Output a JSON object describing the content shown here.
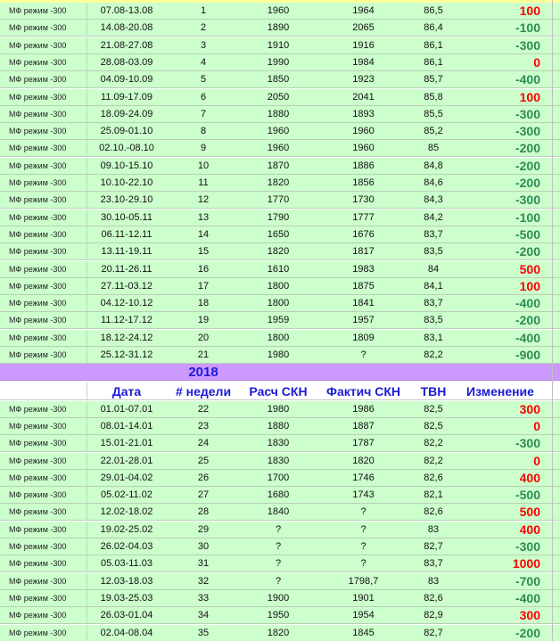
{
  "label_prefix": "МФ режим -300",
  "year_title": "2018",
  "headers": [
    "Дата",
    "# недели",
    "Расч СКН",
    "Фактич СКН",
    "ТВН",
    "Изменение"
  ],
  "rows_2017": [
    {
      "label": "МФ режим -300",
      "date": "07.08-13.08",
      "week": "1",
      "calc": "1960",
      "fact": "1964",
      "tvn": "86,5",
      "change": "100",
      "sign": "pos"
    },
    {
      "label": "МФ режим -300",
      "date": "14.08-20.08",
      "week": "2",
      "calc": "1890",
      "fact": "2065",
      "tvn": "86,4",
      "change": "-100",
      "sign": "neg"
    },
    {
      "label": "МФ режим -300",
      "date": "21.08-27.08",
      "week": "3",
      "calc": "1910",
      "fact": "1916",
      "tvn": "86,1",
      "change": "-300",
      "sign": "neg"
    },
    {
      "label": "МФ режим -300",
      "date": "28.08-03.09",
      "week": "4",
      "calc": "1990",
      "fact": "1984",
      "tvn": "86,1",
      "change": "0",
      "sign": "pos"
    },
    {
      "label": "МФ режим -300",
      "date": "04.09-10.09",
      "week": "5",
      "calc": "1850",
      "fact": "1923",
      "tvn": "85,7",
      "change": "-400",
      "sign": "neg"
    },
    {
      "label": "МФ режим -300",
      "date": "11.09-17.09",
      "week": "6",
      "calc": "2050",
      "fact": "2041",
      "tvn": "85,8",
      "change": "100",
      "sign": "pos"
    },
    {
      "label": "МФ режим -300",
      "date": "18.09-24.09",
      "week": "7",
      "calc": "1880",
      "fact": "1893",
      "tvn": "85,5",
      "change": "-300",
      "sign": "neg"
    },
    {
      "label": "МФ режим -300",
      "date": "25.09-01.10",
      "week": "8",
      "calc": "1960",
      "fact": "1960",
      "tvn": "85,2",
      "change": "-300",
      "sign": "neg"
    },
    {
      "label": "МФ режим -300",
      "date": "02.10.-08.10",
      "week": "9",
      "calc": "1960",
      "fact": "1960",
      "tvn": "85",
      "change": "-200",
      "sign": "neg"
    },
    {
      "label": "МФ режим -300",
      "date": "09.10-15.10",
      "week": "10",
      "calc": "1870",
      "fact": "1886",
      "tvn": "84,8",
      "change": "-200",
      "sign": "neg"
    },
    {
      "label": "МФ режим -300",
      "date": "10.10-22.10",
      "week": "11",
      "calc": "1820",
      "fact": "1856",
      "tvn": "84,6",
      "change": "-200",
      "sign": "neg"
    },
    {
      "label": "МФ режим -300",
      "date": "23.10-29.10",
      "week": "12",
      "calc": "1770",
      "fact": "1730",
      "tvn": "84,3",
      "change": "-300",
      "sign": "neg"
    },
    {
      "label": "МФ режим -300",
      "date": "30.10-05.11",
      "week": "13",
      "calc": "1790",
      "fact": "1777",
      "tvn": "84,2",
      "change": "-100",
      "sign": "neg"
    },
    {
      "label": "МФ режим -300",
      "date": "06.11-12.11",
      "week": "14",
      "calc": "1650",
      "fact": "1676",
      "tvn": "83,7",
      "change": "-500",
      "sign": "neg"
    },
    {
      "label": "МФ режим -300",
      "date": "13.11-19.11",
      "week": "15",
      "calc": "1820",
      "fact": "1817",
      "tvn": "83,5",
      "change": "-200",
      "sign": "neg"
    },
    {
      "label": "МФ режим -300",
      "date": "20.11-26.11",
      "week": "16",
      "calc": "1610",
      "fact": "1983",
      "tvn": "84",
      "change": "500",
      "sign": "pos"
    },
    {
      "label": "МФ режим -300",
      "date": "27.11-03.12",
      "week": "17",
      "calc": "1800",
      "fact": "1875",
      "tvn": "84,1",
      "change": "100",
      "sign": "pos"
    },
    {
      "label": "МФ режим -300",
      "date": "04.12-10.12",
      "week": "18",
      "calc": "1800",
      "fact": "1841",
      "tvn": "83,7",
      "change": "-400",
      "sign": "neg"
    },
    {
      "label": "МФ режим -300",
      "date": "11.12-17.12",
      "week": "19",
      "calc": "1959",
      "fact": "1957",
      "tvn": "83,5",
      "change": "-200",
      "sign": "neg"
    },
    {
      "label": "МФ режим -300",
      "date": "18.12-24.12",
      "week": "20",
      "calc": "1800",
      "fact": "1809",
      "tvn": "83,1",
      "change": "-400",
      "sign": "neg"
    },
    {
      "label": "МФ режим -300",
      "date": "25.12-31.12",
      "week": "21",
      "calc": "1980",
      "fact": "?",
      "tvn": "82,2",
      "change": "-900",
      "sign": "neg"
    }
  ],
  "rows_2018": [
    {
      "label": "МФ режим -300",
      "date": "01.01-07.01",
      "week": "22",
      "calc": "1980",
      "fact": "1986",
      "tvn": "82,5",
      "change": "300",
      "sign": "pos"
    },
    {
      "label": "МФ режим -300",
      "date": "08.01-14.01",
      "week": "23",
      "calc": "1880",
      "fact": "1887",
      "tvn": "82,5",
      "change": "0",
      "sign": "pos"
    },
    {
      "label": "МФ режим -300",
      "date": "15.01-21.01",
      "week": "24",
      "calc": "1830",
      "fact": "1787",
      "tvn": "82,2",
      "change": "-300",
      "sign": "neg"
    },
    {
      "label": "МФ режим -300",
      "date": "22.01-28.01",
      "week": "25",
      "calc": "1830",
      "fact": "1820",
      "tvn": "82,2",
      "change": "0",
      "sign": "pos"
    },
    {
      "label": "МФ режим -300",
      "date": "29.01-04.02",
      "week": "26",
      "calc": "1700",
      "fact": "1746",
      "tvn": "82,6",
      "change": "400",
      "sign": "pos"
    },
    {
      "label": "МФ режим -300",
      "date": "05.02-11.02",
      "week": "27",
      "calc": "1680",
      "fact": "1743",
      "tvn": "82,1",
      "change": "-500",
      "sign": "neg"
    },
    {
      "label": "МФ режим -300",
      "date": "12.02-18.02",
      "week": "28",
      "calc": "1840",
      "fact": "?",
      "tvn": "82,6",
      "change": "500",
      "sign": "pos"
    },
    {
      "label": "МФ режим -300",
      "date": "19.02-25.02",
      "week": "29",
      "calc": "?",
      "fact": "?",
      "tvn": "83",
      "change": "400",
      "sign": "pos"
    },
    {
      "label": "МФ режим -300",
      "date": "26.02-04.03",
      "week": "30",
      "calc": "?",
      "fact": "?",
      "tvn": "82,7",
      "change": "-300",
      "sign": "neg"
    },
    {
      "label": "МФ режим -300",
      "date": "05.03-11.03",
      "week": "31",
      "calc": "?",
      "fact": "?",
      "tvn": "83,7",
      "change": "1000",
      "sign": "pos"
    },
    {
      "label": "МФ режим -300",
      "date": "12.03-18.03",
      "week": "32",
      "calc": "?",
      "fact": "1798,7",
      "tvn": "83",
      "change": "-700",
      "sign": "neg"
    },
    {
      "label": "МФ режим -300",
      "date": "19.03-25.03",
      "week": "33",
      "calc": "1900",
      "fact": "1901",
      "tvn": "82,6",
      "change": "-400",
      "sign": "neg"
    },
    {
      "label": "МФ режим -300",
      "date": "26.03-01.04",
      "week": "34",
      "calc": "1950",
      "fact": "1954",
      "tvn": "82,9",
      "change": "300",
      "sign": "pos"
    },
    {
      "label": "МФ режим -300",
      "date": "02.04-08.04",
      "week": "35",
      "calc": "1820",
      "fact": "1845",
      "tvn": "82,7",
      "change": "-200",
      "sign": "neg"
    }
  ],
  "colors": {
    "row_bg": "#ccffcc",
    "year_bg": "#cc99ff",
    "positive": "#ff0000",
    "negative": "#2e8b57",
    "header_text": "#1b1bd6"
  }
}
